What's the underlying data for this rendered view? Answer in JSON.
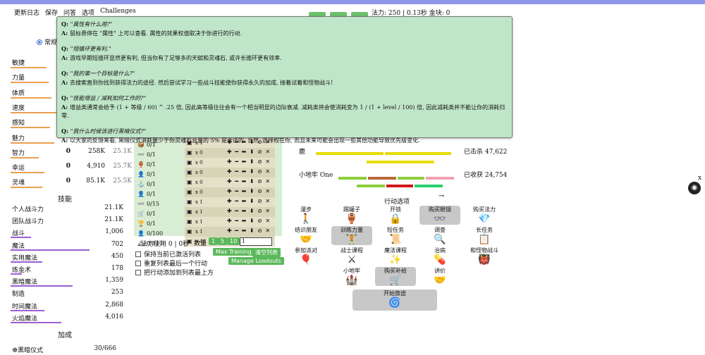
{
  "menu": [
    "更新日志",
    "保存",
    "问答",
    "选项",
    "Challenges"
  ],
  "topstats": "法力: 250 | 0.13秒 金块: 0",
  "radio_label": "常规",
  "stats": [
    {
      "name": "敏捷",
      "lv": "",
      "v1": "",
      "v2": ""
    },
    {
      "name": "力量",
      "lv": "",
      "v1": "",
      "v2": ""
    },
    {
      "name": "体质",
      "lv": "",
      "v1": "",
      "v2": ""
    },
    {
      "name": "速度",
      "lv": "",
      "v1": "",
      "v2": ""
    },
    {
      "name": "感知",
      "lv": "",
      "v1": "",
      "v2": ""
    },
    {
      "name": "魅力",
      "lv": "",
      "v1": "",
      "v2": ""
    },
    {
      "name": "智力",
      "lv": "0",
      "v1": "258K",
      "v2": "25.1K"
    },
    {
      "name": "幸运",
      "lv": "0",
      "v1": "4,910",
      "v2": "25.7K"
    },
    {
      "name": "灵魂",
      "lv": "0",
      "v1": "85.1K",
      "v2": "25.5K"
    }
  ],
  "skills_title": "技能",
  "skills": [
    {
      "name": "个人战斗力",
      "value": "21.1K",
      "bar": 0
    },
    {
      "name": "团队战斗力",
      "value": "21.1K",
      "bar": 0
    },
    {
      "name": "战斗",
      "value": "1,006",
      "bar": 0.18
    },
    {
      "name": "魔法",
      "value": "702",
      "bar": 0.7
    },
    {
      "name": "实用魔法",
      "value": "450",
      "bar": 0.28
    },
    {
      "name": "炼金术",
      "value": "178",
      "bar": 0.1
    },
    {
      "name": "黑暗魔法",
      "value": "1,359",
      "bar": 0.55
    },
    {
      "name": "制造",
      "value": "253",
      "bar": 0.0
    },
    {
      "name": "时间魔法",
      "value": "2,868",
      "bar": 0.3
    },
    {
      "name": "火焰魔法",
      "value": "4,016",
      "bar": 0.45
    }
  ],
  "buffs_title": "加成",
  "buff": {
    "name": "黑暗仪式",
    "value": "30/666"
  },
  "loadout_left": [
    "0/1",
    "0/1",
    "0/1",
    "0/1",
    "0/1",
    "0/1",
    "0/15",
    "0/1",
    "0/1",
    "0/100",
    "0/111"
  ],
  "loadout_right": [
    "x 1",
    "x 0",
    "x 0",
    "x 0",
    "x 0",
    "x 0",
    "x 1",
    "x 1",
    "x 1",
    "x 1",
    "x 46"
  ],
  "options": [
    "保持当前已激活列表",
    "重复列表最后一个行动",
    "把行动添加到列表最上方"
  ],
  "buttons": {
    "max_training": "Max Training",
    "clear": "清空列表",
    "manage": "Manage Loadouts"
  },
  "mana_usage": "法力使用 0 | 0秒",
  "quantity": {
    "label": "数量",
    "opts": [
      "1",
      "5",
      "10"
    ],
    "value": "1"
  },
  "right": {
    "deer": "鹿",
    "killed": "已击杀 47,622",
    "dungeon": "小地牢 One",
    "harvested": "已收获 24,754",
    "actions_title": "行动选项",
    "arrow": "→"
  },
  "actions": [
    {
      "label": "漫步",
      "icon": "🚶"
    },
    {
      "label": "踢罐子",
      "icon": "🏺"
    },
    {
      "label": "开锁",
      "icon": "🔒"
    },
    {
      "label": "购买眼镜",
      "icon": "👓"
    },
    {
      "label": "购买法力",
      "icon": "💎"
    },
    {
      "label": "结识朋友",
      "icon": "🤝"
    },
    {
      "label": "训练力量",
      "icon": "🏋"
    },
    {
      "label": "短任务",
      "icon": "📜"
    },
    {
      "label": "调查",
      "icon": "🔍"
    },
    {
      "label": "长任务",
      "icon": "📋"
    },
    {
      "label": "参加派对",
      "icon": "🎈"
    },
    {
      "label": "战士课程",
      "icon": "⚔"
    },
    {
      "label": "魔法课程",
      "icon": "✨"
    },
    {
      "label": "治病",
      "icon": "💊"
    },
    {
      "label": "和怪物战斗",
      "icon": "👹"
    },
    {
      "label": "小地牢",
      "icon": "🏰"
    },
    {
      "label": "购买补给",
      "icon": "🛒"
    },
    {
      "label": "讲价",
      "icon": "🤝"
    },
    {
      "label": "开始旅途",
      "icon": "🌀"
    }
  ],
  "faq": [
    {
      "q": "\"属性有什么用?\"",
      "a": "鼠标悬停在 \"属性\" 上可以查看. 属性的效果权值取决于你进行的行动."
    },
    {
      "q": "\"短循环更有利.\"",
      "a": "游戏早期短循环显然更有利, 但当你有了足够多的天赋和灵魂石, 或许长循环更有效率."
    },
    {
      "q": "\"我的第一个目标是什么?\"",
      "a": "去搜索直到你找到获得法力的途径. 然后尝试学习一些战斗技能使你获得永久的加成, 接着试着和怪物战斗!"
    },
    {
      "q": "\"技能增益 / 减耗如何工作的?\"",
      "a": "增益类通常会给予 (1 + 等级 / 60) ^ .25 倍, 因此高等级往往会有一个相当明显的边际衰减. 减耗类将会使消耗变为 1 / (1 + level / 100) 倍, 因此减耗类并不能让你的消耗归零."
    },
    {
      "q": "\"我什么时候该进行黑暗仪式?\"",
      "a": "以大家的反馈来看, 黑暗仪式消耗量少于你灵魂石总量的 5% 是合适的. 当然, 选择权在你, 而且未来可能会出现一些其他功能导致优先级变化."
    }
  ]
}
